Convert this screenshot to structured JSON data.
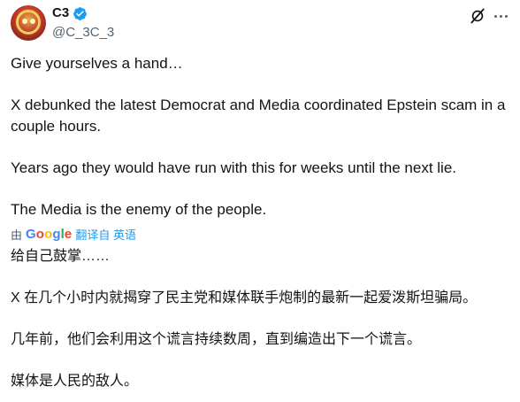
{
  "author": {
    "display_name": "C3",
    "handle": "@C_3C_3"
  },
  "tweet": {
    "lines": [
      "Give yourselves a hand…",
      "X debunked the latest Democrat and Media coordinated Epstein scam in a couple hours.",
      "Years ago they would have run with this for weeks until the next lie.",
      "The Media is the enemy of the people."
    ]
  },
  "translation": {
    "by_label": "由",
    "provider": "Google",
    "translate_from_label": "翻译自 英语",
    "lines": [
      "给自己鼓掌……",
      "X 在几个小时内就揭穿了民主党和媒体联手炮制的最新一起爱泼斯坦骗局。",
      "几年前，他们会利用这个谎言持续数周，直到编造出下一个谎言。",
      "媒体是人民的敌人。"
    ]
  },
  "icons": {
    "verified": "verified-badge-icon",
    "grok": "grok-icon",
    "more": "more-options-icon"
  },
  "colors": {
    "accent": "#1d9bf0",
    "secondary_text": "#536471",
    "text": "#0f1419"
  }
}
